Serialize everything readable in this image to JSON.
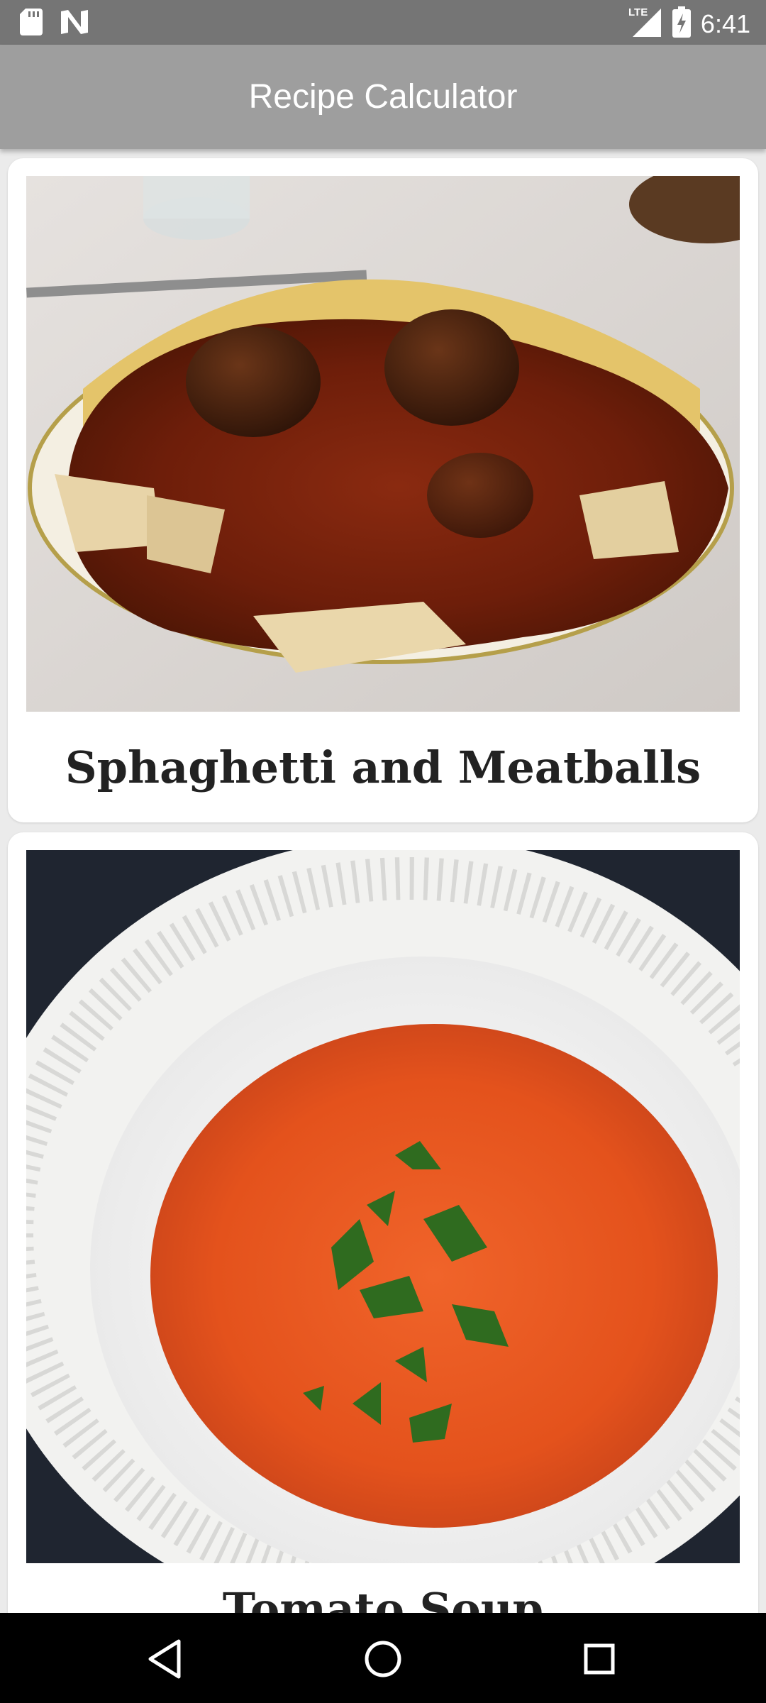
{
  "status_bar": {
    "time": "6:41",
    "network": "LTE",
    "icons": [
      "sd-card-icon",
      "notification-n-icon",
      "lte-signal-icon",
      "battery-icon"
    ]
  },
  "app_bar": {
    "title": "Recipe Calculator"
  },
  "recipes": [
    {
      "title": "Sphaghetti and Meatballs",
      "image": "spaghetti-meatballs-photo"
    },
    {
      "title": "Tomato Soup",
      "image": "tomato-soup-photo"
    }
  ],
  "nav_bar": {
    "icons": [
      "back-icon",
      "home-icon",
      "recents-icon"
    ]
  },
  "colors": {
    "status_bar": "#757575",
    "app_bar": "#9e9e9e",
    "background": "#ebebeb",
    "card": "#ffffff",
    "nav_bar": "#000000"
  }
}
